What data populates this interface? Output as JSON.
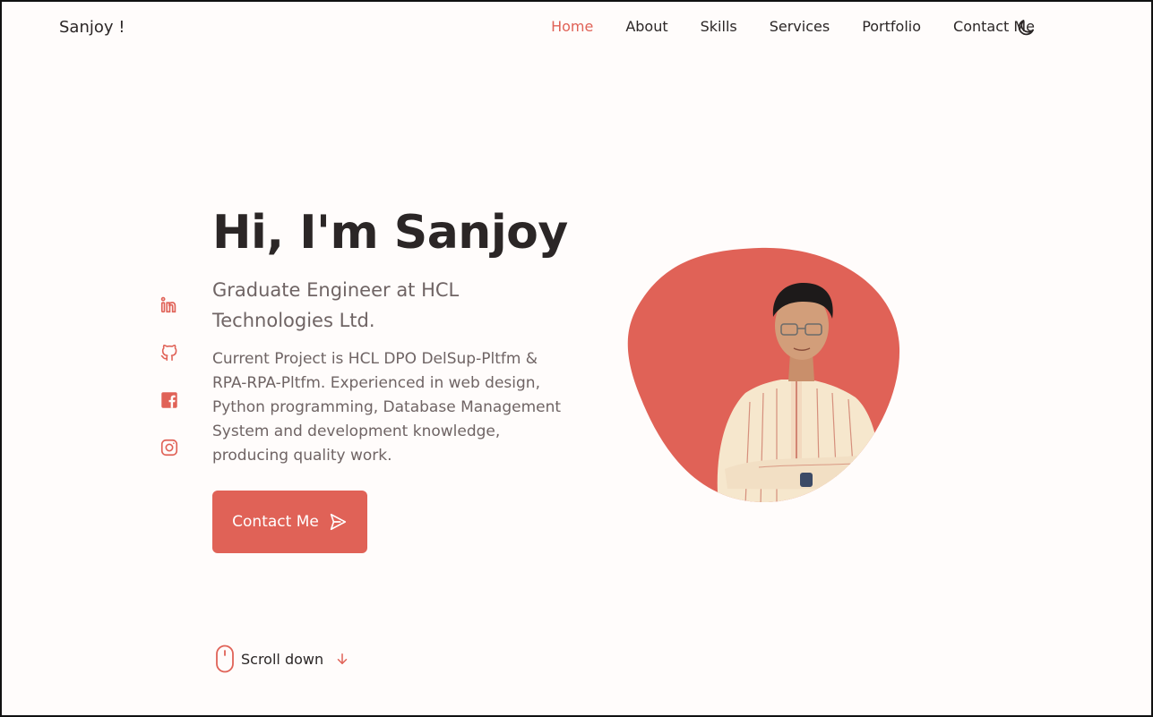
{
  "header": {
    "logo": "Sanjoy !",
    "nav": [
      {
        "label": "Home",
        "active": true
      },
      {
        "label": "About",
        "active": false
      },
      {
        "label": "Skills",
        "active": false
      },
      {
        "label": "Services",
        "active": false
      },
      {
        "label": "Portfolio",
        "active": false
      },
      {
        "label": "Contact Me",
        "active": false
      }
    ],
    "theme_icon": "moon-icon"
  },
  "social": [
    "linkedin-icon",
    "github-icon",
    "facebook-icon",
    "instagram-icon"
  ],
  "hero": {
    "title": "Hi, I'm Sanjoy",
    "subtitle": "Graduate Engineer at HCL Technologies Ltd.",
    "description": "Current Project is HCL DPO DelSup-Pltfm & RPA-RPA-Pltfm. Experienced in web design, Python programming, Database Management System and development knowledge, producing quality work.",
    "cta_label": "Contact Me",
    "cta_icon": "send-icon"
  },
  "scroll": {
    "label": "Scroll down",
    "mouse_icon": "mouse-icon",
    "arrow_icon": "arrow-down-icon"
  },
  "colors": {
    "accent": "#e06257",
    "text": "#2b2626",
    "muted": "#6f6464",
    "background": "#fffcfb"
  }
}
